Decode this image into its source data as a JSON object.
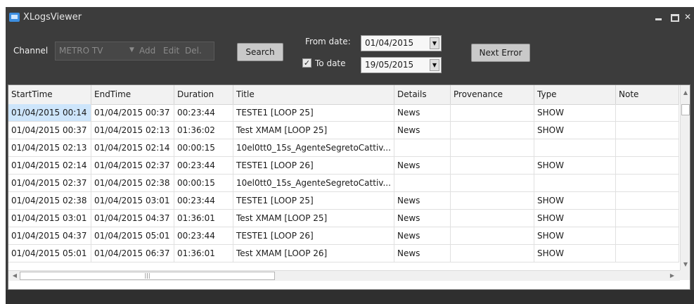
{
  "window": {
    "title": "XLogsViewer"
  },
  "toolbar": {
    "channel_label": "Channel",
    "channel_value": "METRO TV",
    "add_label": "Add",
    "edit_label": "Edit",
    "del_label": "Del.",
    "search_label": "Search",
    "from_date_label": "From date:",
    "from_date_value": "01/04/2015",
    "to_date_checked": true,
    "to_date_label": "To date",
    "to_date_value": "19/05/2015",
    "next_error_label": "Next Error"
  },
  "grid": {
    "columns": [
      "StartTime",
      "EndTime",
      "Duration",
      "Title",
      "Details",
      "Provenance",
      "Type",
      "Note"
    ],
    "selected_row": 0,
    "selected_col": 0,
    "rows": [
      [
        "01/04/2015 00:14",
        "01/04/2015 00:37",
        "00:23:44",
        "TESTE1 [LOOP 25]",
        "News",
        "",
        "SHOW",
        ""
      ],
      [
        "01/04/2015 00:37",
        "01/04/2015 02:13",
        "01:36:02",
        "Test XMAM [LOOP 25]",
        "News",
        "",
        "SHOW",
        ""
      ],
      [
        "01/04/2015 02:13",
        "01/04/2015 02:14",
        "00:00:15",
        "10el0tt0_15s_AgenteSegretoCattiv...",
        "",
        "",
        "",
        ""
      ],
      [
        "01/04/2015 02:14",
        "01/04/2015 02:37",
        "00:23:44",
        "TESTE1 [LOOP 26]",
        "News",
        "",
        "SHOW",
        ""
      ],
      [
        "01/04/2015 02:37",
        "01/04/2015 02:38",
        "00:00:15",
        "10el0tt0_15s_AgenteSegretoCattiv...",
        "",
        "",
        "",
        ""
      ],
      [
        "01/04/2015 02:38",
        "01/04/2015 03:01",
        "00:23:44",
        "TESTE1 [LOOP 25]",
        "News",
        "",
        "SHOW",
        ""
      ],
      [
        "01/04/2015 03:01",
        "01/04/2015 04:37",
        "01:36:01",
        "Test XMAM [LOOP 25]",
        "News",
        "",
        "SHOW",
        ""
      ],
      [
        "01/04/2015 04:37",
        "01/04/2015 05:01",
        "00:23:44",
        "TESTE1 [LOOP 26]",
        "News",
        "",
        "SHOW",
        ""
      ],
      [
        "01/04/2015 05:01",
        "01/04/2015 06:37",
        "01:36:01",
        "Test XMAM [LOOP 26]",
        "News",
        "",
        "SHOW",
        ""
      ]
    ]
  },
  "icons": {
    "app": "app-monitor-icon",
    "minimize": "minimize-icon",
    "maximize": "maximize-icon",
    "close": "close-icon",
    "dropdown": "chevron-down-icon",
    "checkbox": "checkmark-icon",
    "scroll_left": "arrow-left-icon",
    "scroll_right": "arrow-right-icon",
    "scroll_up": "arrow-up-icon",
    "scroll_down": "arrow-down-icon"
  },
  "colors": {
    "window_bg": "#3c3c3c",
    "selection": "#cde5fb",
    "button": "#c9c9c9"
  }
}
